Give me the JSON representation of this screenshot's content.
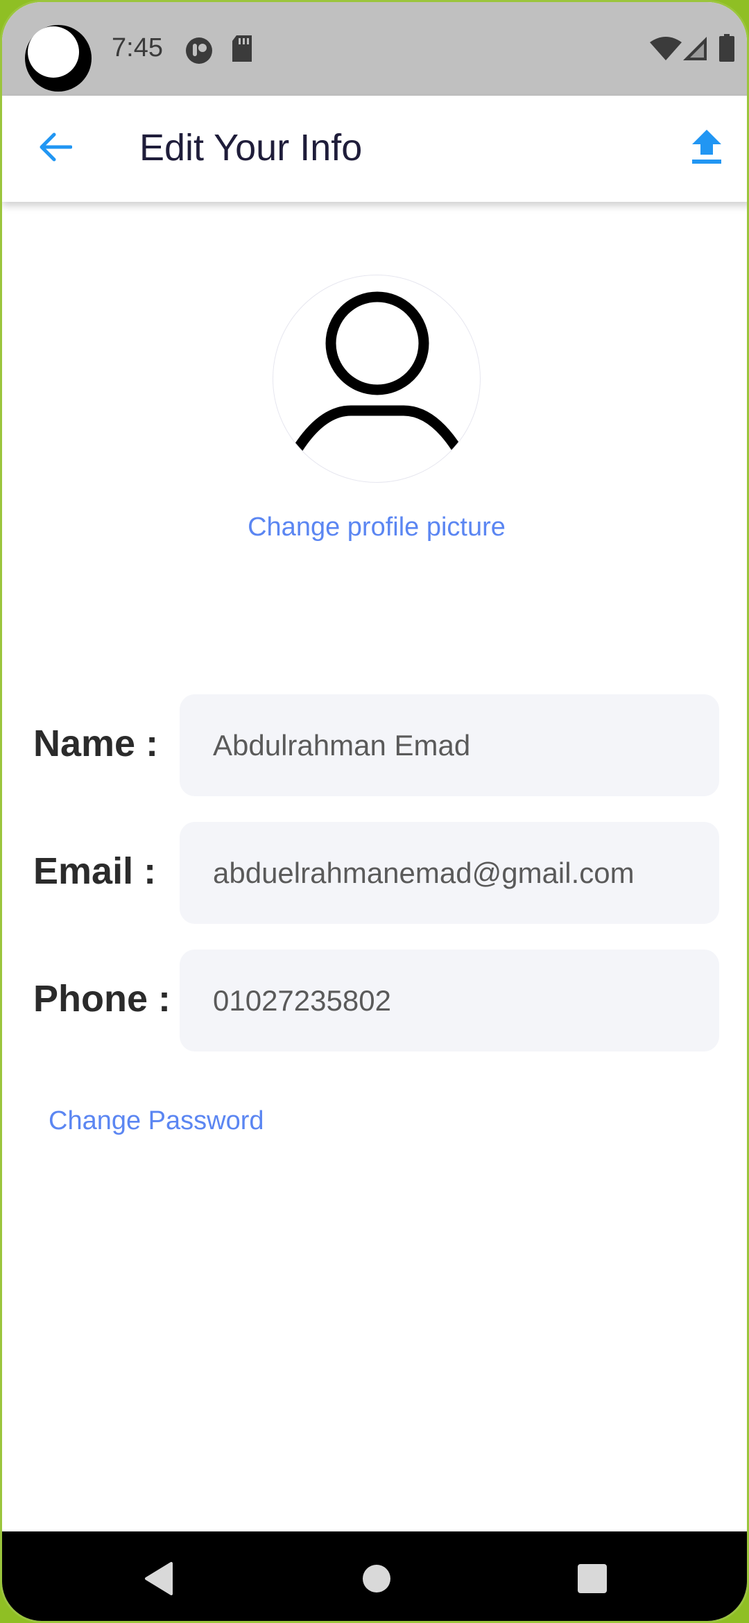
{
  "status_bar": {
    "time": "7:45",
    "icons": [
      "wifi-icon",
      "cell-signal-icon",
      "battery-icon",
      "notification-icon",
      "sd-card-icon"
    ]
  },
  "app_bar": {
    "title": "Edit Your Info",
    "back_icon": "arrow-left-icon",
    "action_icon": "upload-icon",
    "accent_color": "#2196f3"
  },
  "profile": {
    "avatar_icon": "person-icon",
    "change_picture_label": "Change profile picture"
  },
  "form": {
    "fields": [
      {
        "label": "Name :",
        "value": "Abdulrahman Emad"
      },
      {
        "label": "Email :",
        "value": "abduelrahmanemad@gmail.com"
      },
      {
        "label": "Phone :",
        "value": "01027235802"
      }
    ],
    "change_password_label": "Change Password"
  },
  "colors": {
    "link": "#5b86f2",
    "input_bg": "#f4f5f9",
    "title": "#1f1d3a"
  },
  "nav_bar": {
    "icons": [
      "back-triangle-icon",
      "home-circle-icon",
      "recents-square-icon"
    ]
  }
}
